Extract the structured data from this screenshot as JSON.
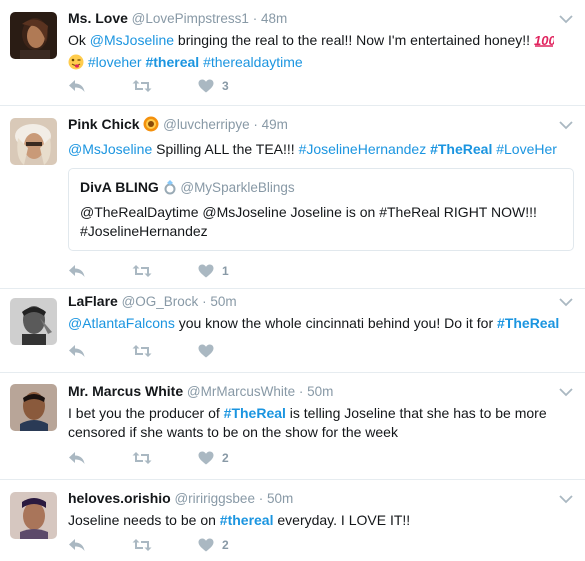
{
  "tweets": [
    {
      "name": "Ms. Love",
      "handle": "@LovePimpstress1",
      "time": "48m",
      "text_parts": [
        {
          "t": "Ok "
        },
        {
          "t": "@MsJoseline",
          "c": "mention"
        },
        {
          "t": " bringing the real to the real!! Now I'm entertained honey!! "
        }
      ],
      "emoji": [
        "hundred-points-emoji",
        "winking-tongue-emoji"
      ],
      "tags": [
        "#loveher",
        "#thereal",
        "#therealdaytime"
      ],
      "likes": "3"
    },
    {
      "name": "Pink Chick",
      "handle": "@luvcherripye",
      "time": "49m",
      "name_emoji": "flower-emoji",
      "mention": "@MsJoseline",
      "text": " Spilling ALL the TEA!!! ",
      "tags": [
        "#JoselineHernandez",
        "#TheReal",
        "#LoveHer"
      ],
      "quote": {
        "name": "DivA BLING",
        "name_emoji": "ring-emoji",
        "handle": "@MySparkleBlings",
        "text": "@TheRealDaytime @MsJoseline  Joseline is on #TheReal RIGHT NOW!!! #JoselineHernandez"
      },
      "likes": "1"
    },
    {
      "name": "LaFlare",
      "handle": "@OG_Brock",
      "time": "50m",
      "mention": "@AtlantaFalcons",
      "text": " you know the whole cincinnati behind you! Do it for ",
      "tag": "#TheReal",
      "likes": ""
    },
    {
      "name": "Mr. Marcus White",
      "handle": "@MrMarcusWhite",
      "time": "50m",
      "text_before": "I bet you the producer of ",
      "tag": "#TheReal",
      "text_after": " is telling Joseline that she has to be more censored if she wants to be on the show for the week",
      "likes": "2"
    },
    {
      "name": "heloves.orishio",
      "handle": "@riririggsbee",
      "time": "50m",
      "text_before": "Joseline needs to be on ",
      "tag": "#thereal",
      "text_after": " everyday. I LOVE IT!!",
      "likes": "2"
    }
  ],
  "separator": "·",
  "icons": {
    "reply": "reply-icon",
    "retweet": "retweet-icon",
    "like": "heart-icon",
    "more": "chevron-down-icon"
  },
  "colors": {
    "link": "#1b95e0",
    "muted": "#8899a6",
    "icon": "#aab8c2",
    "border": "#e6ecf0"
  }
}
